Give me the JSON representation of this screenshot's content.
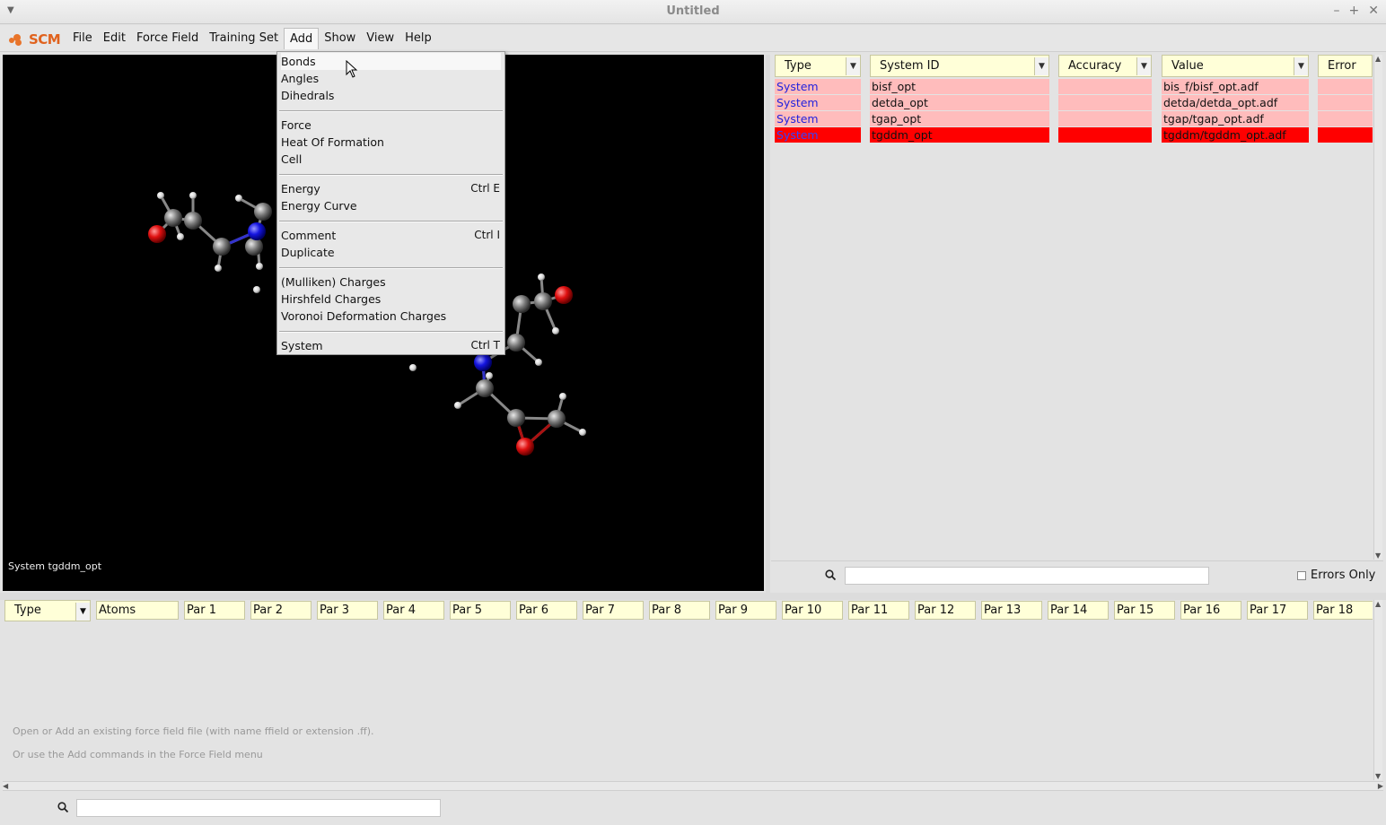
{
  "window": {
    "title": "Untitled"
  },
  "app": {
    "logo_text": "SCM"
  },
  "menubar": {
    "items": [
      "File",
      "Edit",
      "Force Field",
      "Training Set",
      "Add",
      "Show",
      "View",
      "Help"
    ],
    "active": "Add"
  },
  "add_menu": {
    "groups": [
      [
        {
          "label": "Bonds",
          "shortcut": ""
        },
        {
          "label": "Angles",
          "shortcut": ""
        },
        {
          "label": "Dihedrals",
          "shortcut": ""
        }
      ],
      [
        {
          "label": "Force",
          "shortcut": ""
        },
        {
          "label": "Heat Of Formation",
          "shortcut": ""
        },
        {
          "label": "Cell",
          "shortcut": ""
        }
      ],
      [
        {
          "label": "Energy",
          "shortcut": "Ctrl E"
        },
        {
          "label": "Energy Curve",
          "shortcut": ""
        }
      ],
      [
        {
          "label": "Comment",
          "shortcut": "Ctrl I"
        },
        {
          "label": "Duplicate",
          "shortcut": ""
        }
      ],
      [
        {
          "label": "(Mulliken) Charges",
          "shortcut": ""
        },
        {
          "label": "Hirshfeld Charges",
          "shortcut": ""
        },
        {
          "label": "Voronoi Deformation Charges",
          "shortcut": ""
        }
      ],
      [
        {
          "label": "System",
          "shortcut": "Ctrl T"
        }
      ]
    ]
  },
  "viewer": {
    "caption": "System tgddm_opt"
  },
  "training_table": {
    "columns": [
      "Type",
      "System ID",
      "Accuracy",
      "Value",
      "Error"
    ],
    "rows": [
      {
        "type": "System",
        "system_id": "bisf_opt",
        "accuracy": "",
        "value": "bis_f/bisf_opt.adf",
        "error": "",
        "selected": false
      },
      {
        "type": "System",
        "system_id": "detda_opt",
        "accuracy": "",
        "value": "detda/detda_opt.adf",
        "error": "",
        "selected": false
      },
      {
        "type": "System",
        "system_id": "tgap_opt",
        "accuracy": "",
        "value": "tgap/tgap_opt.adf",
        "error": "",
        "selected": false
      },
      {
        "type": "System",
        "system_id": "tgddm_opt",
        "accuracy": "",
        "value": "tgddm/tgddm_opt.adf",
        "error": "",
        "selected": true
      }
    ]
  },
  "top_search": {
    "placeholder": "",
    "errors_only_label": "Errors Only"
  },
  "param_table": {
    "type_label": "Type",
    "columns": [
      "Atoms",
      "Par 1",
      "Par 2",
      "Par 3",
      "Par 4",
      "Par 5",
      "Par 6",
      "Par 7",
      "Par 8",
      "Par 9",
      "Par 10",
      "Par 11",
      "Par 12",
      "Par 13",
      "Par 14",
      "Par 15",
      "Par 16",
      "Par 17",
      "Par 18"
    ],
    "hint_line1": "Open or Add an existing force field file (with name ffield or extension .ff).",
    "hint_line2": "Or use the Add commands in the Force Field menu"
  },
  "bottom_search": {
    "placeholder": ""
  },
  "colors": {
    "row_bg": "#ffbcbc",
    "row_selected": "#ff0000",
    "header_bg": "#ffffd8",
    "type_text": "#2222dd",
    "accent": "#e0621d"
  }
}
